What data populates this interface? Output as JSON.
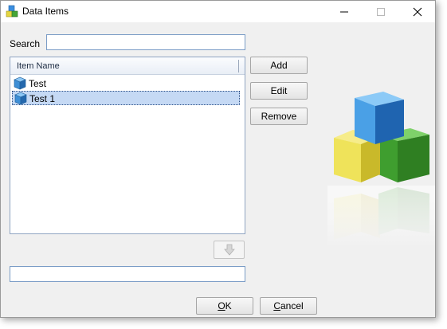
{
  "window": {
    "title": "Data Items",
    "app_icon": "data-cubes-icon",
    "controls": [
      "minimize-icon",
      "maximize-icon",
      "close-icon"
    ]
  },
  "search": {
    "label": "Search",
    "value": "",
    "placeholder": ""
  },
  "list": {
    "column_header": "Item Name",
    "item_icon": "cube-icon",
    "items": [
      {
        "label": "Test",
        "selected": false
      },
      {
        "label": "Test 1",
        "selected": true
      }
    ]
  },
  "buttons": {
    "add": "Add",
    "edit": "Edit",
    "remove": "Remove",
    "move_down_icon": "arrow-down-icon"
  },
  "bottom_field": {
    "value": ""
  },
  "footer": {
    "ok_accel": "O",
    "ok_rest": "K",
    "cancel_accel": "C",
    "cancel_rest": "ancel"
  },
  "colors": {
    "selection": "#c5d9f4",
    "cube_blue": "#3f8fd8",
    "cube_yellow": "#e8d84a",
    "cube_green": "#4aa83a"
  }
}
